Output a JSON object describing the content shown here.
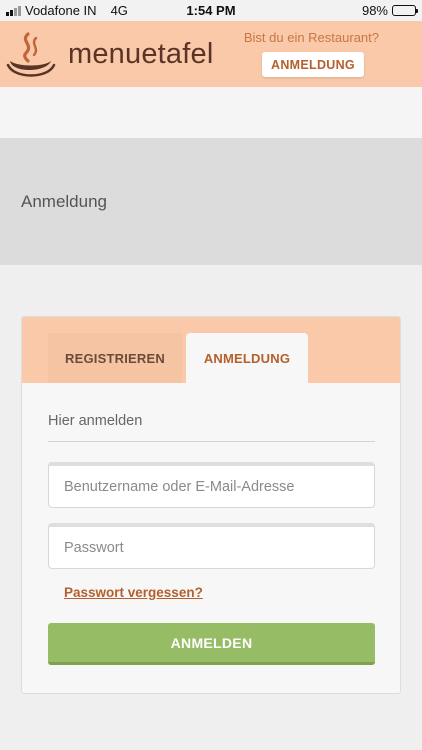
{
  "status_bar": {
    "carrier": "Vodafone IN",
    "network": "4G",
    "time": "1:54 PM",
    "battery": "98%",
    "battery_level": 0.98
  },
  "header": {
    "logo_text": "menuetafel",
    "promo_text": "Bist du ein Restaurant?",
    "login_button": "ANMELDUNG"
  },
  "page": {
    "title": "Anmeldung"
  },
  "login_card": {
    "tabs": [
      {
        "label": "REGISTRIEREN",
        "active": false
      },
      {
        "label": "ANMELDUNG",
        "active": true
      }
    ],
    "subtitle": "Hier anmelden",
    "username_placeholder": "Benutzername oder E-Mail-Adresse",
    "password_placeholder": "Passwort",
    "forgot_link": "Passwort vergessen?",
    "submit_button": "ANMELDEN"
  },
  "colors": {
    "header_bg": "#f9c9a9",
    "accent": "#b5602c",
    "submit_green": "#96bd65",
    "logo_brown": "#5a3426"
  },
  "icons": {
    "logo": "steaming-cup-icon",
    "signal": "cellular-signal-icon",
    "battery": "battery-icon"
  }
}
